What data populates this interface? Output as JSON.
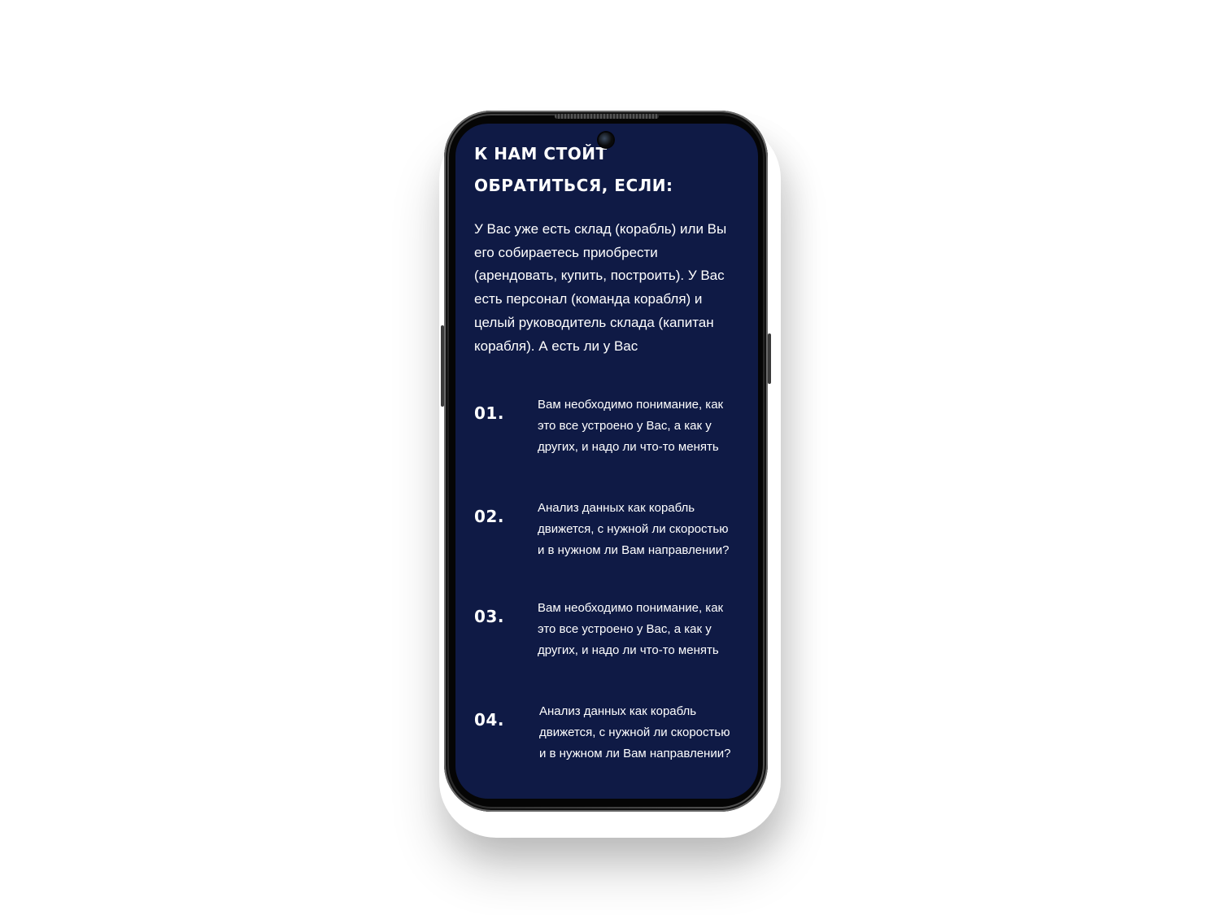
{
  "background_color": "#ffffff",
  "screen_color": "#0f1a45",
  "text_color": "#ffffff",
  "screen": {
    "heading": "К НАМ СТОЙТ ОБРАТИТЬСЯ, ЕСЛИ:",
    "intro": "У Вас уже есть склад (корабль) или Вы его собираетесь приобрести (арендовать, купить, построить). У Вас есть персонал (команда корабля) и целый руководитель склада (капитан корабля). А есть ли у Вас",
    "items": [
      {
        "number": "01.",
        "text": "Вам необходимо понимание, как это все устроено у Вас, а как у других, и надо ли что-то менять"
      },
      {
        "number": "02.",
        "text": "Анализ данных как корабль движется, с нужной ли скоростью и в нужном ли Вам направлении?"
      },
      {
        "number": "03.",
        "text": "Вам необходимо понимание, как это все устроено у Вас, а как у других, и надо ли что-то менять"
      },
      {
        "number": "04.",
        "text": "Анализ данных как корабль движется, с нужной ли скоростью и в нужном ли Вам направлении?"
      }
    ]
  }
}
